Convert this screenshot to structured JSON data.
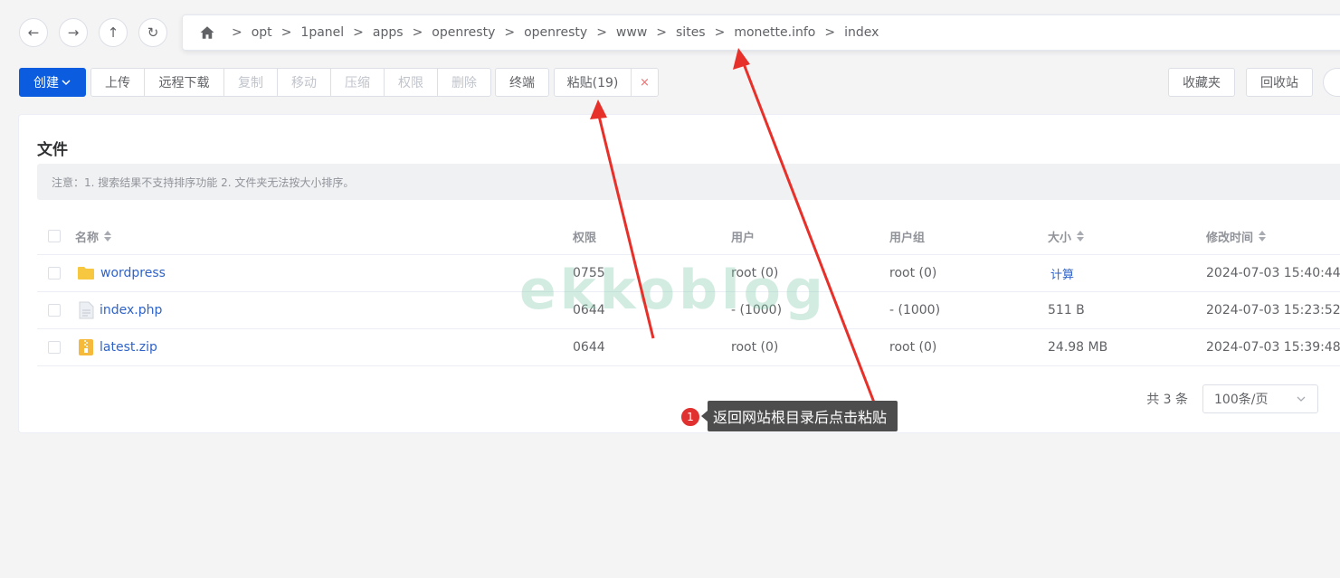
{
  "nav": {
    "back": "←",
    "forward": "→",
    "up": "↑",
    "refresh": "↻"
  },
  "breadcrumb": {
    "separator": ">",
    "items": [
      "opt",
      "1panel",
      "apps",
      "openresty",
      "openresty",
      "www",
      "sites",
      "monette.info",
      "index"
    ]
  },
  "toolbar": {
    "create": "创建",
    "upload": "上传",
    "remote_download": "远程下载",
    "copy": "复制",
    "move": "移动",
    "compress": "压缩",
    "permission": "权限",
    "delete": "删除",
    "terminal": "终端",
    "paste": "粘贴(19)",
    "cancel_paste": "×",
    "favorites": "收藏夹",
    "recycle_bin": "回收站"
  },
  "card": {
    "title": "文件",
    "notice": "注意：1. 搜索结果不支持排序功能 2. 文件夹无法按大小排序。"
  },
  "table": {
    "columns": {
      "name": "名称",
      "permission": "权限",
      "user": "用户",
      "group": "用户组",
      "size": "大小",
      "modified": "修改时间"
    },
    "rows": [
      {
        "icon": "folder-icon",
        "name": "wordpress",
        "permission": "0755",
        "user": "root (0)",
        "group": "root (0)",
        "size": "计算",
        "modified": "2024-07-03 15:40:44"
      },
      {
        "icon": "file-icon",
        "name": "index.php",
        "permission": "0644",
        "user": "- (1000)",
        "group": "- (1000)",
        "size": "511 B",
        "modified": "2024-07-03 15:23:52"
      },
      {
        "icon": "zip-icon",
        "name": "latest.zip",
        "permission": "0644",
        "user": "root (0)",
        "group": "root (0)",
        "size": "24.98 MB",
        "modified": "2024-07-03 15:39:48"
      }
    ]
  },
  "pager": {
    "total": "共 3 条",
    "page_size": "100条/页"
  },
  "watermark": "ekkoblog",
  "annotation": {
    "number": "1",
    "text": "返回网站根目录后点击粘贴"
  },
  "colors": {
    "primary": "#0c5ce0",
    "link": "#2f63c9",
    "arrow": "#e8302a",
    "danger": "#f56c6c"
  }
}
